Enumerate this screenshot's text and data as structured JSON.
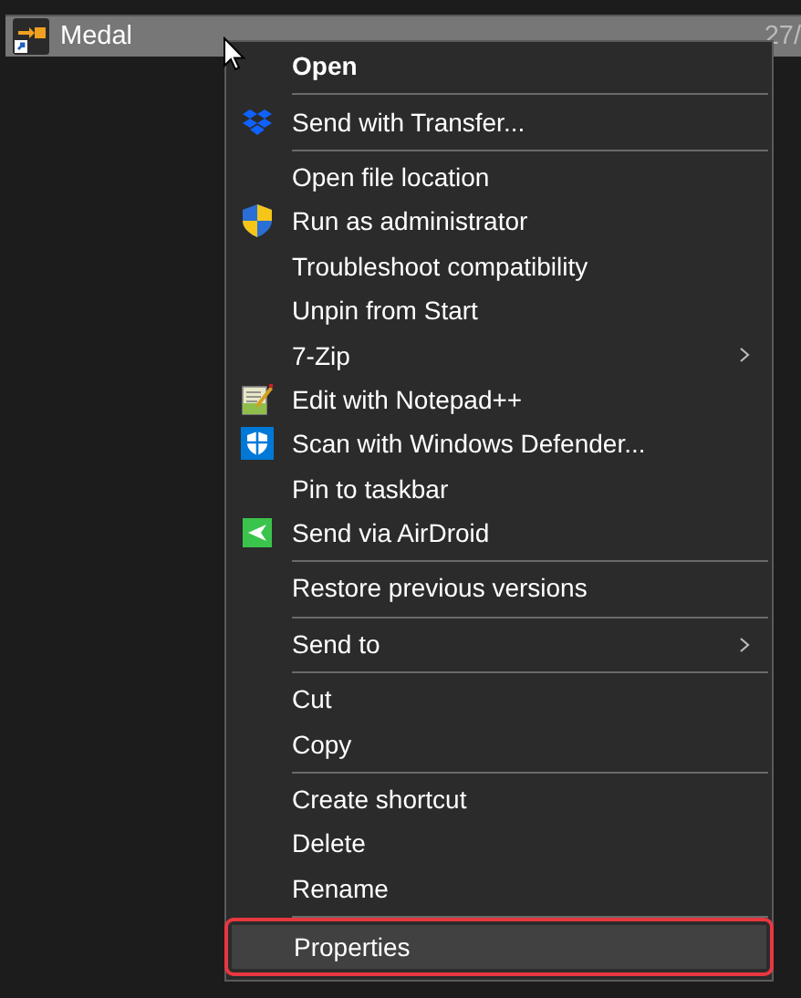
{
  "file_row": {
    "name": "Medal",
    "date": "27/",
    "selected": true
  },
  "context_menu": {
    "items": [
      {
        "kind": "item",
        "label": "Open",
        "default": true
      },
      {
        "kind": "separator"
      },
      {
        "kind": "item",
        "label": "Send with Transfer..."
      },
      {
        "kind": "separator"
      },
      {
        "kind": "item",
        "label": "Open file location"
      },
      {
        "kind": "item",
        "label": "Run as administrator"
      },
      {
        "kind": "item",
        "label": "Troubleshoot compatibility"
      },
      {
        "kind": "item",
        "label": "Unpin from Start"
      },
      {
        "kind": "item",
        "label": "7-Zip",
        "submenu": true
      },
      {
        "kind": "item",
        "label": "Edit with Notepad++"
      },
      {
        "kind": "item",
        "label": "Scan with Windows Defender..."
      },
      {
        "kind": "item",
        "label": "Pin to taskbar"
      },
      {
        "kind": "item",
        "label": "Send via AirDroid"
      },
      {
        "kind": "separator"
      },
      {
        "kind": "item",
        "label": "Restore previous versions"
      },
      {
        "kind": "separator"
      },
      {
        "kind": "item",
        "label": "Send to",
        "submenu": true
      },
      {
        "kind": "separator"
      },
      {
        "kind": "item",
        "label": "Cut"
      },
      {
        "kind": "item",
        "label": "Copy"
      },
      {
        "kind": "separator"
      },
      {
        "kind": "item",
        "label": "Create shortcut"
      },
      {
        "kind": "item",
        "label": "Delete"
      },
      {
        "kind": "item",
        "label": "Rename"
      },
      {
        "kind": "separator"
      },
      {
        "kind": "item",
        "label": "Properties",
        "selected": true,
        "highlighted": true
      }
    ]
  }
}
